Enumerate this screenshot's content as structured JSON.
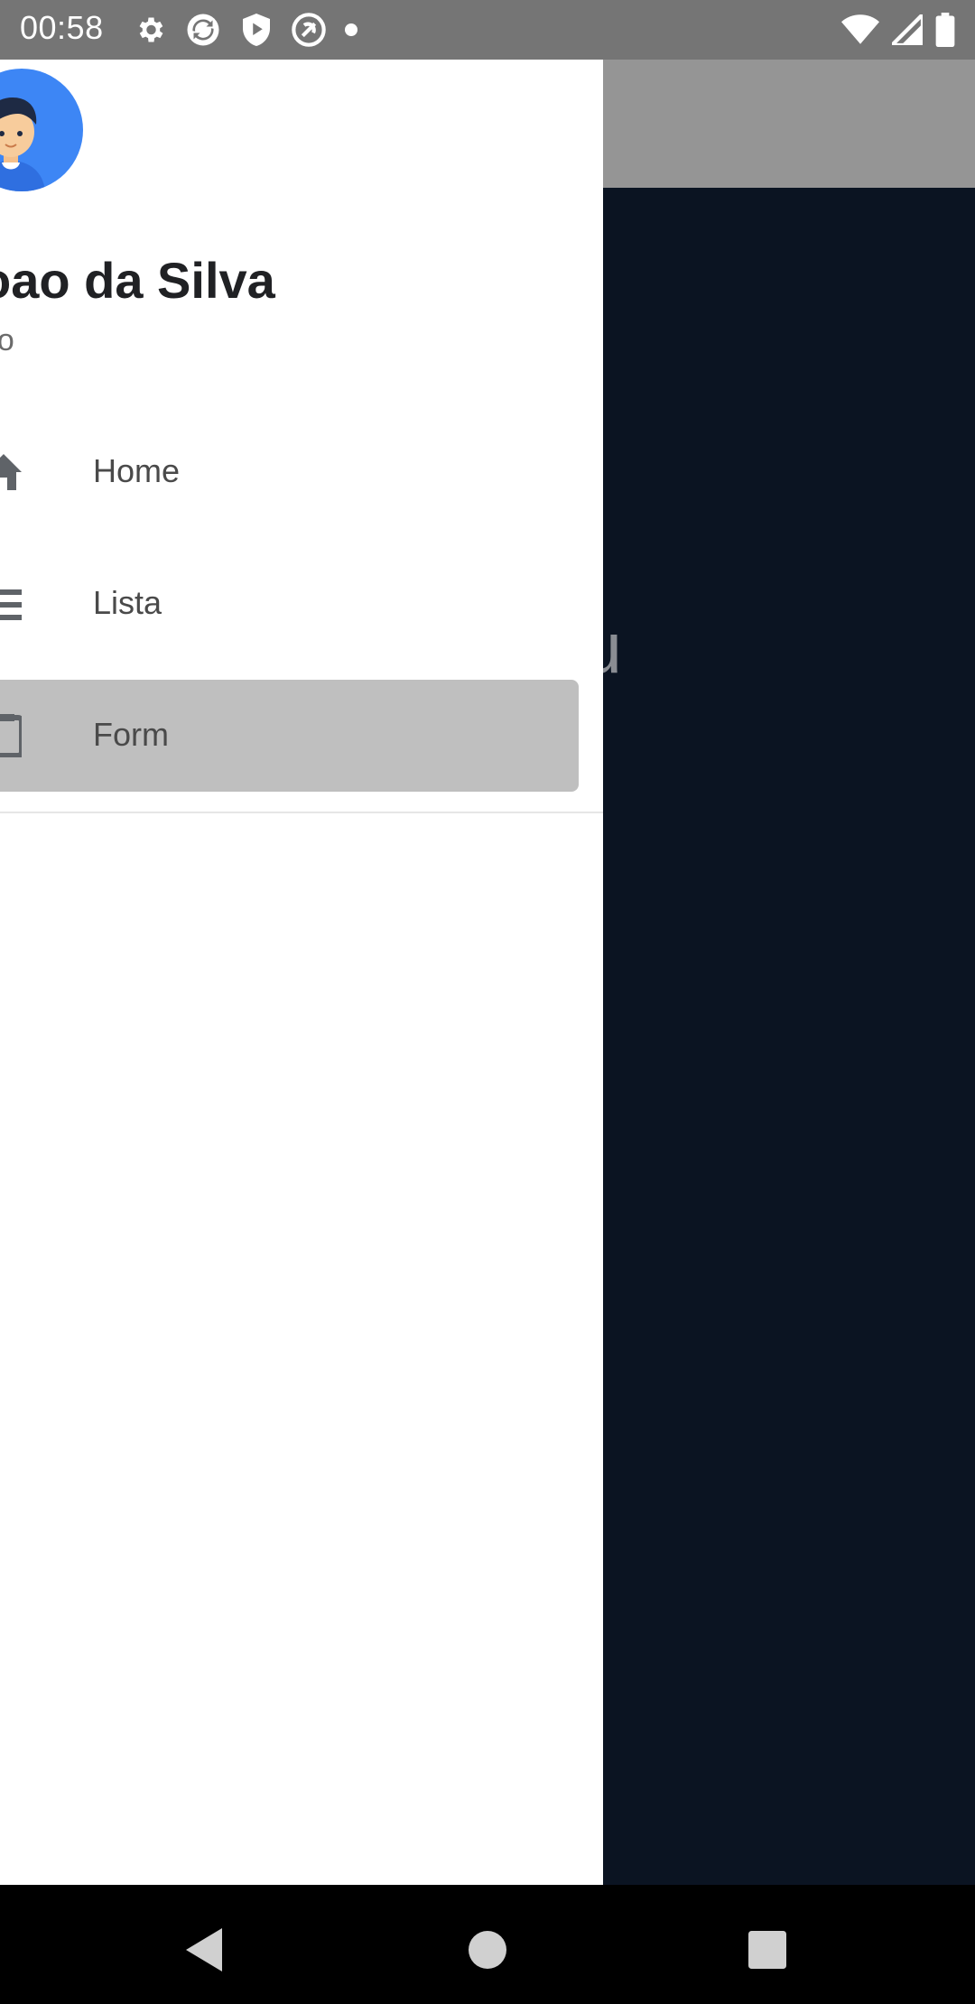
{
  "status_bar": {
    "time": "00:58",
    "left_icons": [
      "gear-icon",
      "sync-icon",
      "shield-play-icon",
      "at-sign-icon",
      "dot-icon"
    ],
    "right_icons": [
      "wifi-icon",
      "cell-signal-icon",
      "battery-icon"
    ]
  },
  "background_app": {
    "visible_text": "seu",
    "toolbar_color": "#959595",
    "body_color": "#0b1422"
  },
  "drawer": {
    "user_name": "oao da Silva",
    "user_handle": "ao",
    "avatar_icon": "user-avatar-icon",
    "menu": [
      {
        "label": "Home",
        "icon": "home-icon",
        "active": false
      },
      {
        "label": "Lista",
        "icon": "list-icon",
        "active": false
      },
      {
        "label": "Form",
        "icon": "form-icon",
        "active": true
      }
    ],
    "active_color": "#bfbfbf"
  },
  "nav_bar": {
    "buttons": [
      "back-icon",
      "home-circle-icon",
      "recents-icon"
    ]
  }
}
